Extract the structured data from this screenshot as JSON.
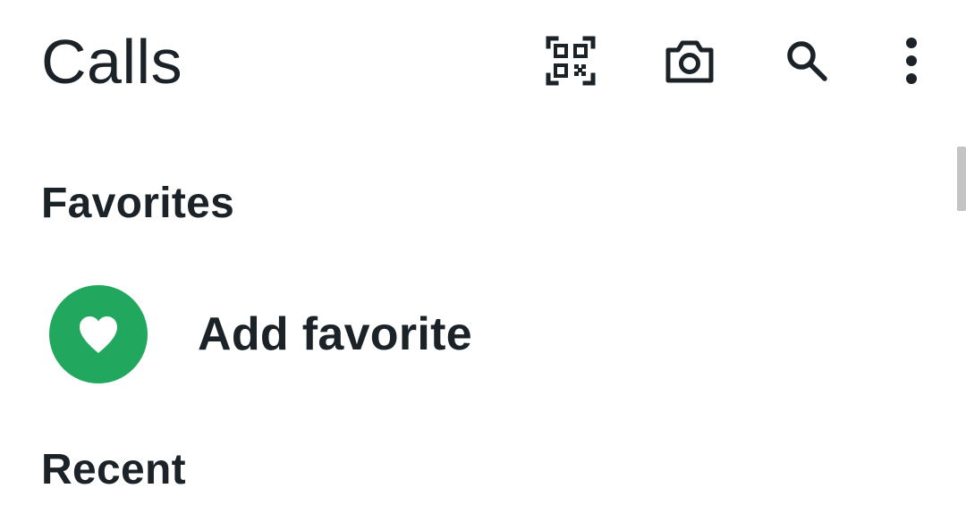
{
  "header": {
    "title": "Calls",
    "actions": [
      {
        "icon": "qr-code-icon"
      },
      {
        "icon": "camera-icon"
      },
      {
        "icon": "search-icon"
      },
      {
        "icon": "more-vertical-icon"
      }
    ]
  },
  "favorites": {
    "heading": "Favorites",
    "add_label": "Add favorite",
    "avatar_icon": "heart-icon",
    "accent_color": "#22a85e"
  },
  "recent": {
    "heading": "Recent"
  }
}
